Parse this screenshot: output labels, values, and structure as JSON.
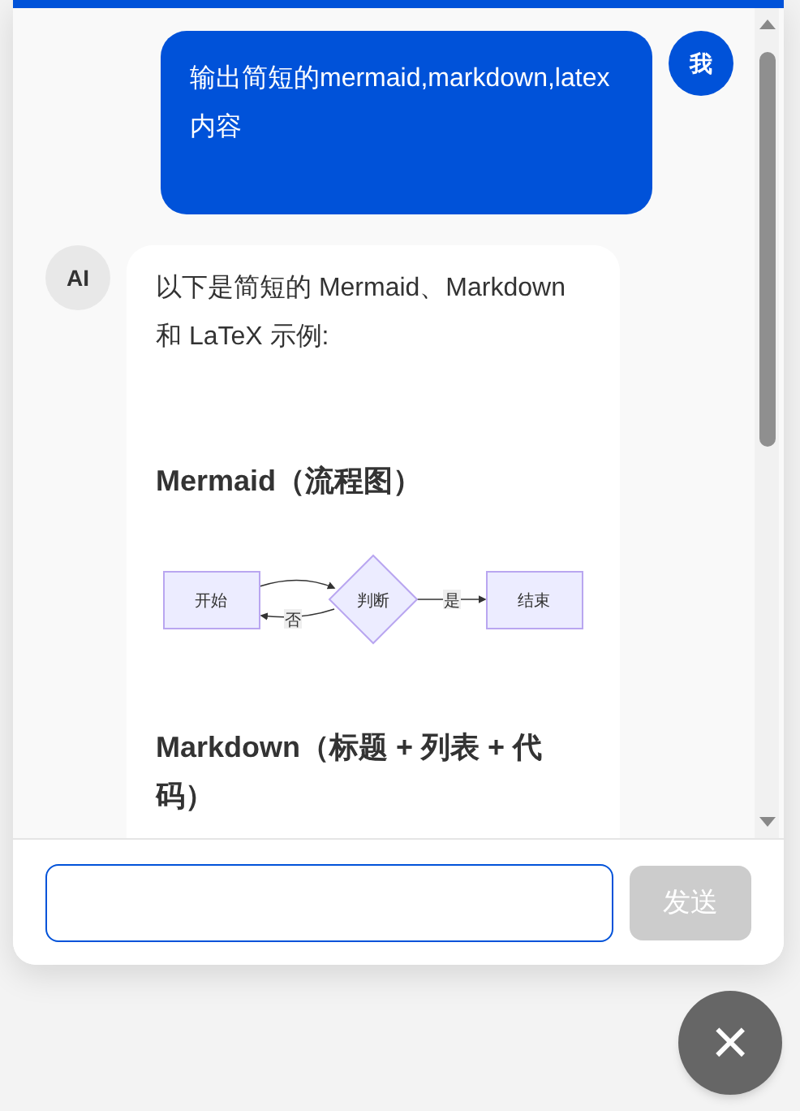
{
  "messages": [
    {
      "kind": "user",
      "avatar": "我",
      "paragraphs": [
        {
          "kind": "text",
          "text": "输出简短的mermaid,markdown,latex内容"
        }
      ]
    },
    {
      "kind": "assistant",
      "avatar": "AI",
      "paragraphs": [
        {
          "kind": "text",
          "text": "以下是简短的 Mermaid、Markdown 和 LaTeX 示例:"
        },
        {
          "kind": "heading",
          "text": "Mermaid（流程图）"
        },
        {
          "kind": "diagram",
          "nodes": [
            {
              "kind": "rect",
              "label": "开始"
            },
            {
              "kind": "diamond",
              "label": "判断"
            },
            {
              "kind": "rect",
              "label": "结束"
            }
          ],
          "edge_labels": [
            "否",
            "是"
          ]
        },
        {
          "kind": "heading",
          "text": "Markdown（标题 + 列表 + 代码）"
        }
      ]
    }
  ],
  "composer": {
    "button": "发送",
    "disabled": true
  },
  "close_button": {
    "label": "×"
  }
}
